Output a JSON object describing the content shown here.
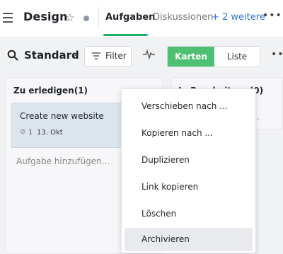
{
  "header": {
    "project_title": "Design",
    "tabs": [
      {
        "label": "Aufgaben"
      },
      {
        "label": "Diskussionen"
      },
      {
        "label": "+ 2 weitere"
      }
    ],
    "more_label": "•••"
  },
  "toolbar": {
    "view_name": "Standard",
    "filter_label": "Filter",
    "segmented": {
      "active": "Karten",
      "inactive": "Liste"
    },
    "more_label": "•••"
  },
  "board": {
    "columns": [
      {
        "header": "Zu erledigen(1)",
        "cards": [
          {
            "title": "Create new website",
            "attachments": "1",
            "date": "13. Okt"
          }
        ],
        "add_label": "Aufgabe hinzufügen..."
      },
      {
        "header": "In Bearbeitung(0)",
        "fragment": "..."
      }
    ]
  },
  "context_menu": {
    "items": [
      {
        "label": "Verschieben nach ..."
      },
      {
        "label": "Kopieren nach ..."
      },
      {
        "label": "Duplizieren"
      },
      {
        "label": "Link kopieren"
      },
      {
        "label": "Löschen"
      },
      {
        "label": "Archivieren",
        "highlighted": true
      }
    ]
  },
  "colors": {
    "accent_green": "#4fbf74",
    "tab_underline": "#20b26b",
    "link_blue": "#2e73d3"
  }
}
